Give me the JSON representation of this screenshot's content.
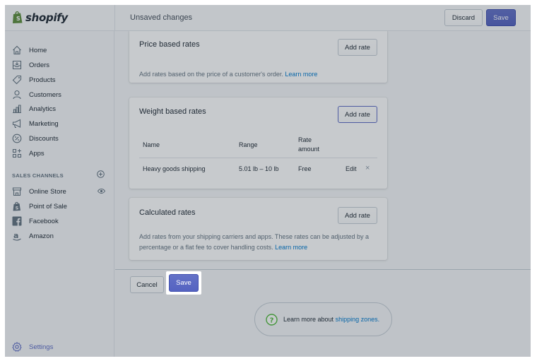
{
  "app": {
    "logo_text": "shopify",
    "unsaved_text": "Unsaved changes",
    "discard_label": "Discard",
    "save_label": "Save"
  },
  "sidebar": {
    "items": [
      {
        "label": "Home",
        "icon": "home-icon"
      },
      {
        "label": "Orders",
        "icon": "orders-icon"
      },
      {
        "label": "Products",
        "icon": "tag-icon"
      },
      {
        "label": "Customers",
        "icon": "person-icon"
      },
      {
        "label": "Analytics",
        "icon": "bar-chart-icon"
      },
      {
        "label": "Marketing",
        "icon": "megaphone-icon"
      },
      {
        "label": "Discounts",
        "icon": "discount-icon"
      },
      {
        "label": "Apps",
        "icon": "apps-icon"
      }
    ],
    "sales_channels_heading": "SALES CHANNELS",
    "channels": [
      {
        "label": "Online Store",
        "icon": "store-icon"
      },
      {
        "label": "Point of Sale",
        "icon": "pos-icon"
      },
      {
        "label": "Facebook",
        "icon": "facebook-icon"
      },
      {
        "label": "Amazon",
        "icon": "amazon-icon"
      }
    ],
    "settings_label": "Settings"
  },
  "price_card": {
    "title": "Price based rates",
    "add_rate_label": "Add rate",
    "description": "Add rates based on the price of a customer's order.",
    "learn_more": "Learn more"
  },
  "weight_card": {
    "title": "Weight based rates",
    "add_rate_label": "Add rate",
    "columns": [
      "Name",
      "Range",
      "Rate amount"
    ],
    "rows": [
      {
        "name": "Heavy goods shipping",
        "range": "5.01 lb – 10 lb",
        "rate": "Free",
        "edit": "Edit",
        "remove": "×"
      }
    ]
  },
  "calculated_card": {
    "title": "Calculated rates",
    "add_rate_label": "Add rate",
    "description": "Add rates from your shipping carriers and apps. These rates can be adjusted by a percentage or a flat fee to cover handling costs.",
    "learn_more": "Learn more"
  },
  "footer": {
    "cancel_label": "Cancel",
    "save_label": "Save"
  },
  "help": {
    "text": "Learn more about",
    "link": "shipping zones."
  },
  "colors": {
    "primary": "#5c6ac4",
    "link": "#007ace",
    "text": "#212b36"
  }
}
